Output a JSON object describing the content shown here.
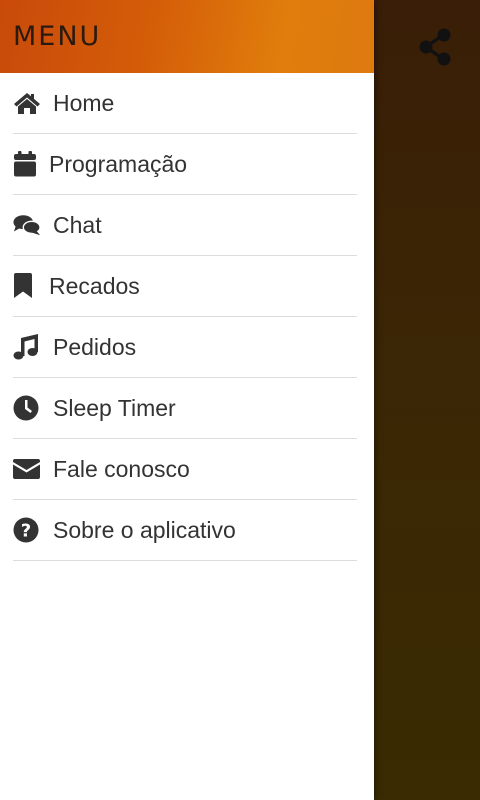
{
  "header": {
    "title": "MENU"
  },
  "menu": {
    "items": [
      {
        "label": "Home",
        "icon": "home-icon"
      },
      {
        "label": "Programação",
        "icon": "calendar-icon"
      },
      {
        "label": "Chat",
        "icon": "chat-icon"
      },
      {
        "label": "Recados",
        "icon": "bookmark-icon"
      },
      {
        "label": "Pedidos",
        "icon": "music-note-icon"
      },
      {
        "label": "Sleep Timer",
        "icon": "clock-icon"
      },
      {
        "label": "Fale conosco",
        "icon": "envelope-icon"
      },
      {
        "label": "Sobre o aplicativo",
        "icon": "question-circle-icon"
      }
    ]
  },
  "toolbar": {
    "share_icon": "share-icon"
  },
  "colors": {
    "header_start": "#c94a0a",
    "header_end": "#e07d0c",
    "icon": "#333333",
    "text": "#333333",
    "backdrop": "#3a2a06"
  }
}
